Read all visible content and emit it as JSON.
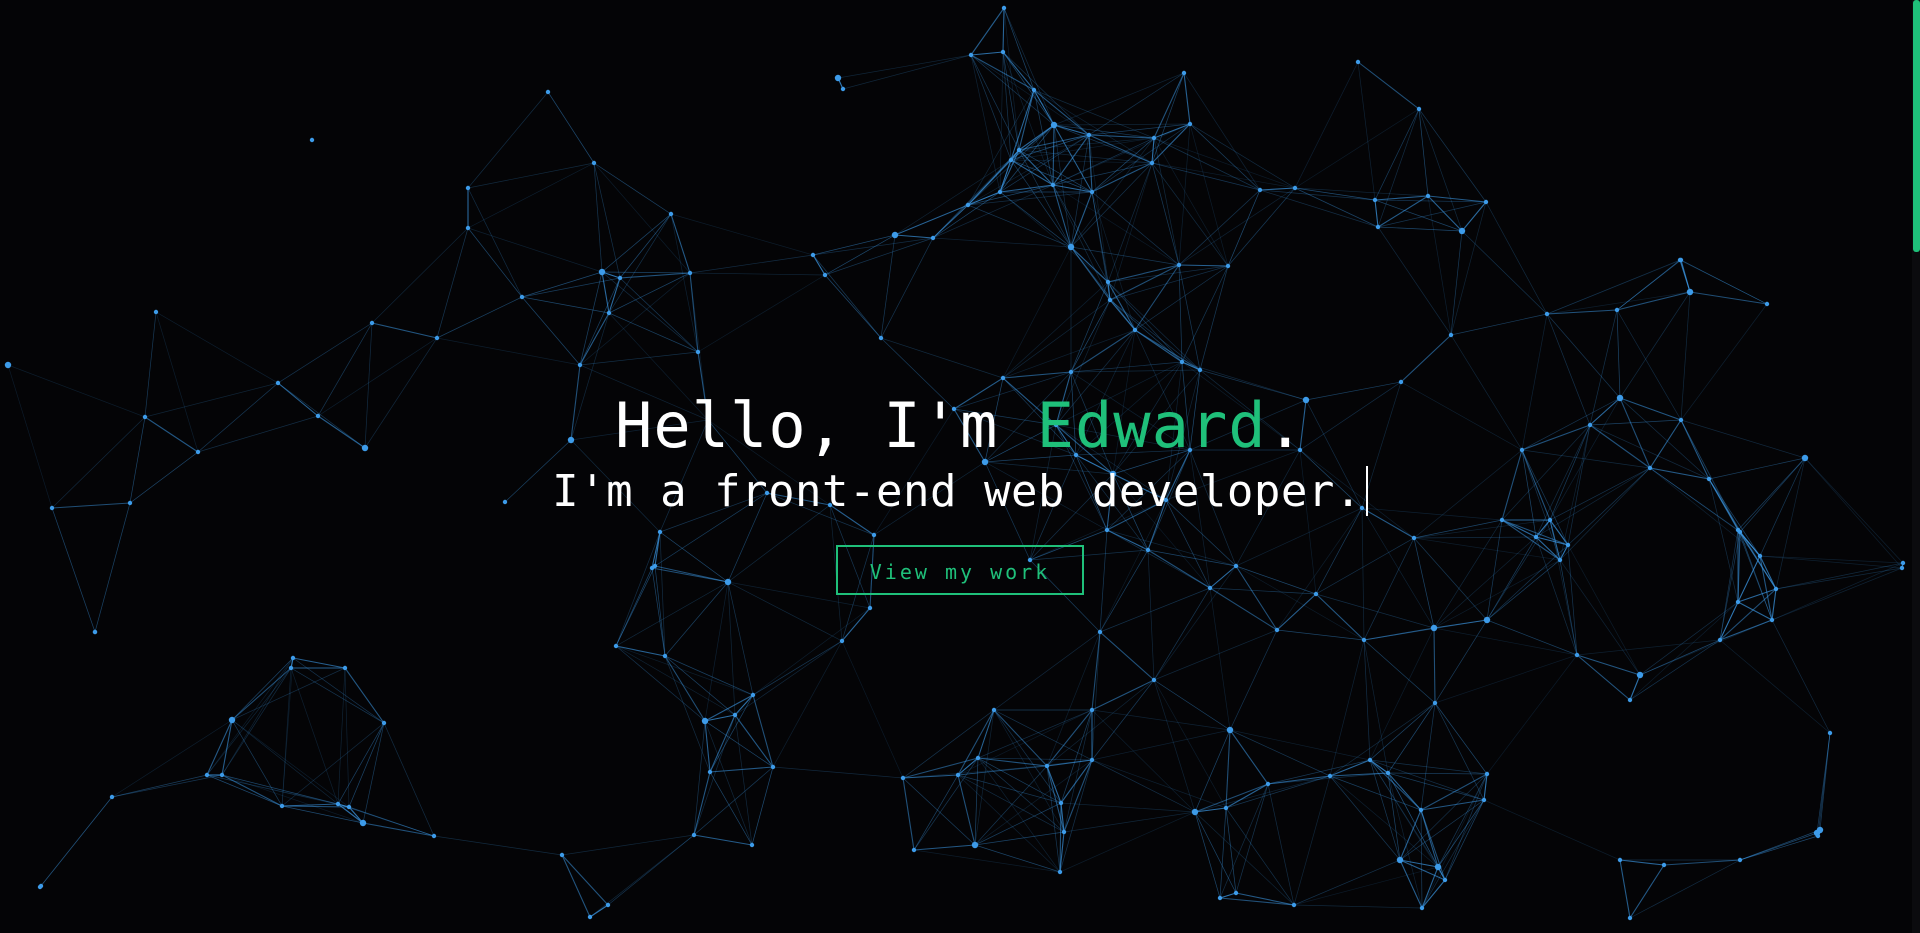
{
  "hero": {
    "greeting_prefix": "Hello, I'm ",
    "name": "Edward",
    "greeting_suffix": ".",
    "tagline": "I'm a front-end web developer.",
    "cta_label": "View my work"
  },
  "colors": {
    "background": "#040406",
    "accent": "#1fc07a",
    "text": "#ffffff",
    "network": "#3d9be9"
  },
  "background_effect": "particle-network"
}
